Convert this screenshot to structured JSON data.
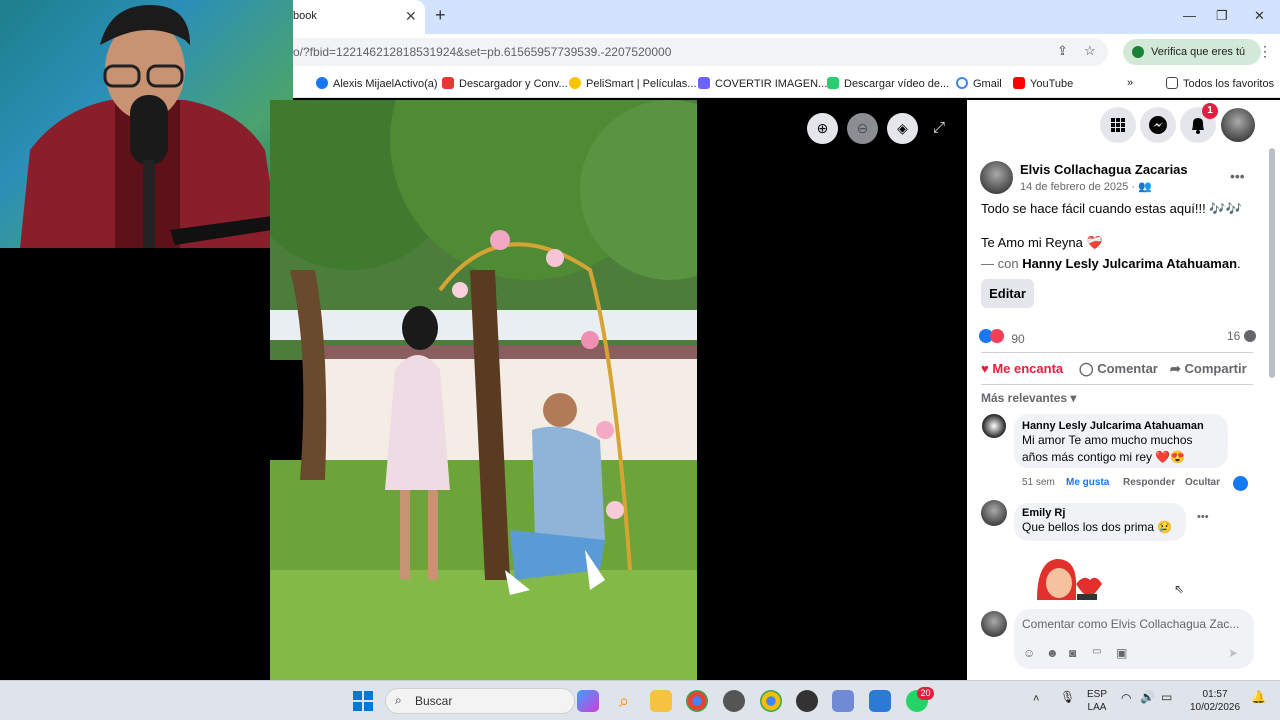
{
  "browser": {
    "tab_title": "book",
    "url": "o/?fbid=122146212818531924&set=pb.61565957739539.-2207520000",
    "verify_label": "Verifica que eres tú",
    "bookmarks": [
      {
        "label": "Alexis MijaelActivo(a)",
        "color": "#1877f2"
      },
      {
        "label": "Descargador y Conv...",
        "color": "#e53935"
      },
      {
        "label": "PeliSmart | Películas...",
        "color": "#f9c300"
      },
      {
        "label": "COVERTIR IMAGEN...",
        "color": "#6c63ff"
      },
      {
        "label": "Descargar vídeo de...",
        "color": "#2ecc71"
      },
      {
        "label": "Gmail",
        "color": "#ea4335"
      },
      {
        "label": "YouTube",
        "color": "#ff0000"
      }
    ],
    "all_favorites": "Todos los favoritos"
  },
  "post": {
    "author": "Elvis Collachagua Zacarias",
    "date": "14 de febrero de 2025",
    "line1": "Todo se hace fácil cuando estas aquí!!! 🎶🎶",
    "line2": "Te Amo mi Reyna ❤️‍🩹",
    "with_prefix": "— con ",
    "with_name": "Hanny Lesly Julcarima Atahuaman",
    "edit_label": "Editar",
    "reaction_count": "90",
    "comment_count": "16",
    "actions": {
      "love": "Me encanta",
      "comment": "Comentar",
      "share": "Compartir"
    },
    "sort_label": "Más relevantes"
  },
  "notifications_badge": "1",
  "comments": [
    {
      "author": "Hanny Lesly Julcarima Atahuaman",
      "line1": "Mi amor Te amo mucho muchos",
      "line2": "años más contigo mi rey ❤️😍",
      "time": "51 sem",
      "like": "Me gusta",
      "reply": "Responder",
      "hide": "Ocultar"
    },
    {
      "author": "Emily Rj",
      "line1": "Que bellos los dos prima 😢"
    }
  ],
  "comment_placeholder": "Comentar como Elvis Collachagua Zac...",
  "taskbar": {
    "search_label": "Buscar",
    "whatsapp_badge": "20",
    "lang_line1": "ESP",
    "lang_line2": "LAA",
    "time": "01:57",
    "date": "10/02/2026"
  }
}
